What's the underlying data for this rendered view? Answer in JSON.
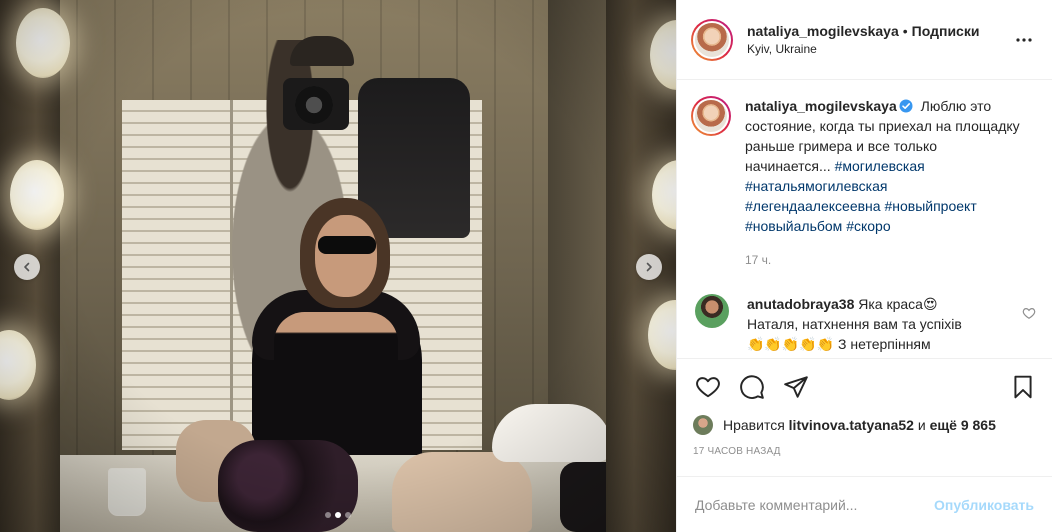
{
  "media": {
    "carousel": {
      "count": 3,
      "active_index": 1
    }
  },
  "header": {
    "username": "nataliya_mogilevskaya",
    "separator": "•",
    "follow_label": "Подписки",
    "location": "Kyiv, Ukraine",
    "more_icon": "more-horizontal-icon"
  },
  "caption": {
    "username": "nataliya_mogilevskaya",
    "verified_icon": "verified-badge-icon",
    "text": "Люблю это состояние, когда ты приехал на площадку раньше гримера и все только начинается...",
    "hashtags": [
      "#могилевская",
      "#натальямогилевская",
      "#легендаалексеевна",
      "#новыйпроект",
      "#новыйальбом",
      "#скоро"
    ],
    "time": "17 ч."
  },
  "comments": [
    {
      "username": "anutadobraya38",
      "text_line1": "Яка краса😍",
      "text_line2": "Наталя, натхнення вам та успіхів",
      "text_line3": "👏👏👏👏👏 З нетерпінням"
    }
  ],
  "actions": {
    "like_icon": "heart-icon",
    "comment_icon": "comment-icon",
    "share_icon": "share-icon",
    "save_icon": "bookmark-icon"
  },
  "likes": {
    "prefix": "Нравится",
    "user": "litvinova.tatyana52",
    "middle": "и",
    "rest": "ещё 9 865"
  },
  "post_time": "17 часов назад",
  "add_comment": {
    "placeholder": "Добавьте комментарий...",
    "publish_label": "Опубликовать"
  },
  "colors": {
    "link": "#00376b",
    "accent": "#0095f6",
    "secondary_text": "#8e8e8e",
    "verified": "#3897f0"
  }
}
